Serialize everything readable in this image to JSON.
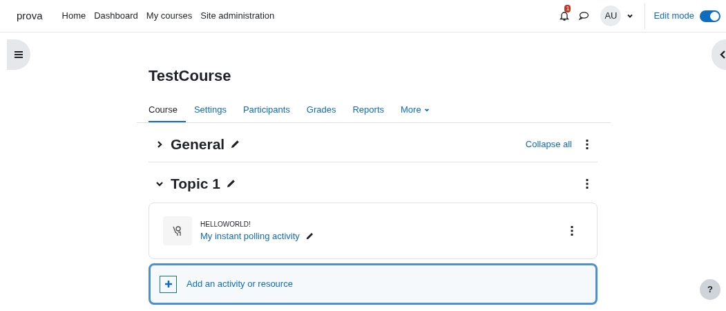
{
  "navbar": {
    "site_name": "prova",
    "links": [
      {
        "label": "Home"
      },
      {
        "label": "Dashboard"
      },
      {
        "label": "My courses"
      },
      {
        "label": "Site administration"
      }
    ],
    "notification_count": "1",
    "avatar": "AU",
    "edit_mode": {
      "label": "Edit mode",
      "on": true
    }
  },
  "course": {
    "title": "TestCourse",
    "tabs": [
      {
        "label": "Course",
        "selected": true
      },
      {
        "label": "Settings",
        "selected": false
      },
      {
        "label": "Participants",
        "selected": false
      },
      {
        "label": "Grades",
        "selected": false
      },
      {
        "label": "Reports",
        "selected": false
      },
      {
        "label": "More",
        "selected": false
      }
    ],
    "collapse_all": "Collapse all",
    "sections": [
      {
        "title": "General",
        "expanded": false
      },
      {
        "title": "Topic 1",
        "expanded": true,
        "activities": [
          {
            "type": "HELLOWORLD!",
            "name": "My instant polling activity"
          }
        ],
        "add_label": "Add an activity or resource"
      }
    ]
  },
  "help_button": "?"
}
